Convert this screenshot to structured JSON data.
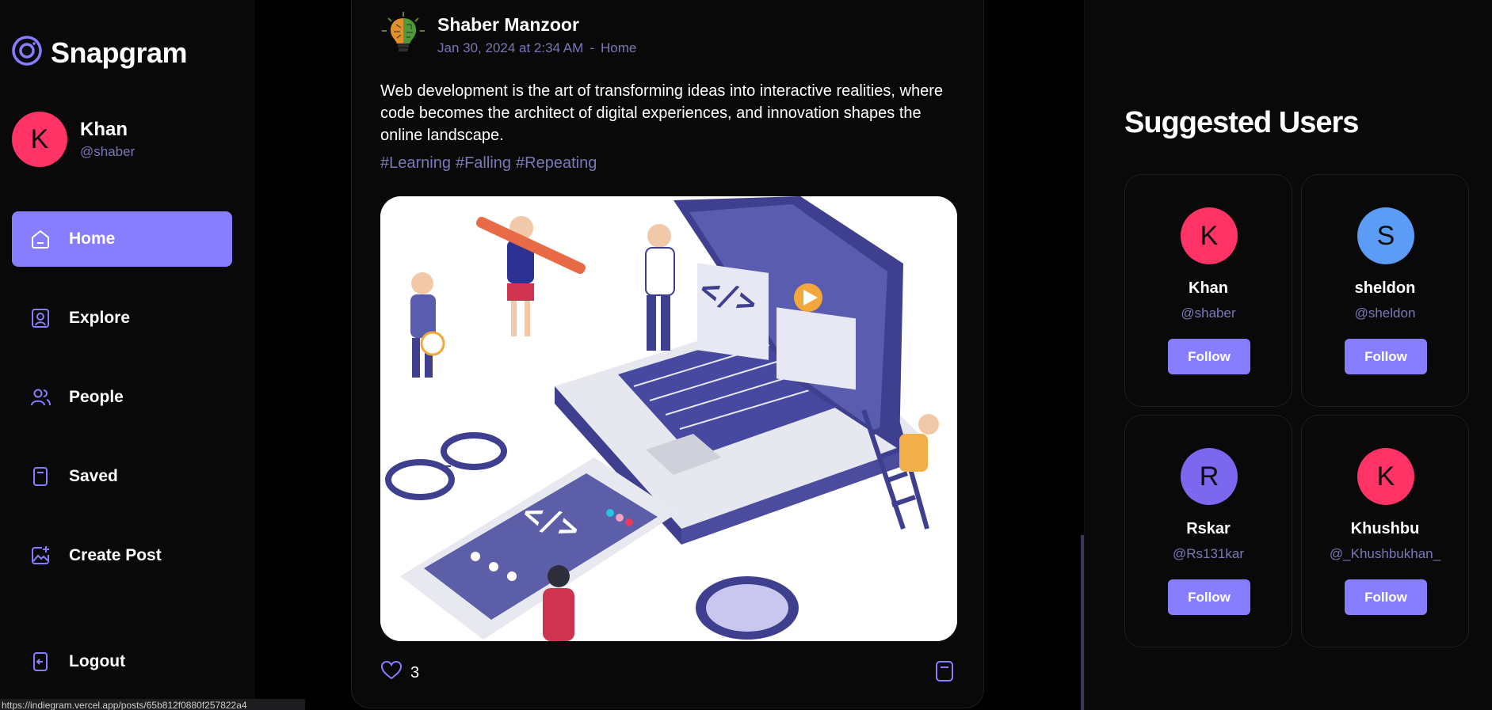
{
  "app": {
    "name": "Snapgram"
  },
  "user": {
    "initial": "K",
    "name": "Khan",
    "handle": "@shaber",
    "color": "#ff3366"
  },
  "nav": {
    "items": [
      {
        "label": "Home",
        "icon": "home-icon",
        "active": true
      },
      {
        "label": "Explore",
        "icon": "explore-icon"
      },
      {
        "label": "People",
        "icon": "people-icon"
      },
      {
        "label": "Saved",
        "icon": "bookmark-icon"
      },
      {
        "label": "Create Post",
        "icon": "create-post-icon"
      }
    ],
    "logout": {
      "label": "Logout",
      "icon": "logout-icon"
    }
  },
  "status_bar": {
    "url": "https://indiegram.vercel.app/posts/65b812f0880f257822a4"
  },
  "post": {
    "author": "Shaber Manzoor",
    "date": "Jan 30, 2024 at 2:34 AM",
    "separator": "-",
    "location": "Home",
    "caption": "Web development is the art of transforming ideas into interactive realities, where code becomes the architect of digital experiences, and innovation shapes the online landscape.",
    "tags": [
      "#Learning",
      "#Falling",
      "#Repeating"
    ],
    "likes": "3"
  },
  "suggested": {
    "title": "Suggested Users",
    "users": [
      {
        "initial": "K",
        "name": "Khan",
        "handle": "@shaber",
        "color": "#ff3366",
        "button": "Follow"
      },
      {
        "initial": "S",
        "name": "sheldon",
        "handle": "@sheldon",
        "color": "#5b9cf6",
        "button": "Follow"
      },
      {
        "initial": "R",
        "name": "Rskar",
        "handle": "@Rs131kar",
        "color": "#7b68ee",
        "button": "Follow"
      },
      {
        "initial": "K",
        "name": "Khushbu",
        "handle": "@_Khushbukhan_",
        "color": "#ff3366",
        "button": "Follow"
      }
    ]
  },
  "colors": {
    "accent": "#877eff",
    "muted": "#7a78b8",
    "background": "#000000",
    "panel": "#09090a"
  }
}
